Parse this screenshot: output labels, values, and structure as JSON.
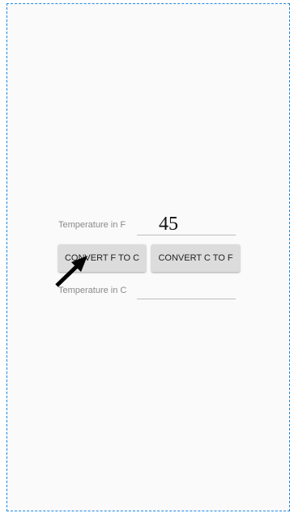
{
  "form": {
    "fahrenheit_label": "Temperature in F",
    "fahrenheit_value": "45",
    "celsius_label": "Temperature in C",
    "celsius_value": ""
  },
  "buttons": {
    "f_to_c_label": "CONVERT F TO C",
    "c_to_f_label": "CONVERT C TO F"
  },
  "colors": {
    "selection_border": "#1e88e5",
    "button_bg": "#dcdcdc",
    "background": "#fafafa"
  },
  "icons": {
    "pointer": "arrow-pointer-icon"
  }
}
